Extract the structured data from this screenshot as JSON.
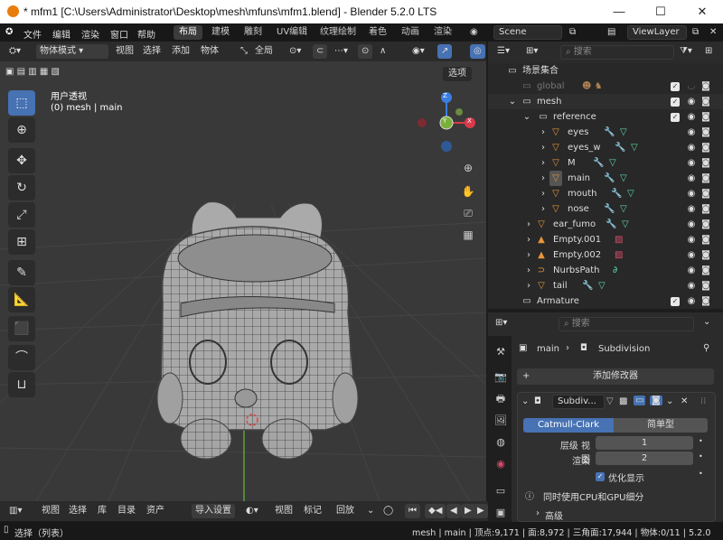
{
  "window": {
    "title": "* mfm1 [C:\\Users\\Administrator\\Desktop\\mesh\\mfuns\\mfm1.blend] - Blender 5.2.0 LTS",
    "minimize": "—",
    "maximize": "☐",
    "close": "✕"
  },
  "menu": {
    "items": [
      "文件",
      "编辑",
      "渲染",
      "窗口",
      "帮助"
    ]
  },
  "workspaces": {
    "tabs": [
      "布局",
      "建模",
      "雕刻",
      "UV编辑",
      "纹理绘制",
      "着色",
      "动画",
      "渲染"
    ],
    "active": "布局"
  },
  "scene": {
    "label": "Scene",
    "view_layer": "ViewLayer"
  },
  "viewport_header": {
    "mode": "物体模式",
    "menus": [
      "视图",
      "选择",
      "添加",
      "物体"
    ],
    "transform": "全局",
    "options": "选项"
  },
  "viewport": {
    "view_name": "用户透视",
    "context": "(0) mesh | main"
  },
  "gizmo": {
    "x": "X",
    "y": "Y",
    "z": "Z"
  },
  "outliner": {
    "search_placeholder": "搜索",
    "root": "场景集合",
    "rows": [
      {
        "name": "global",
        "dim": true
      },
      {
        "name": "mesh"
      },
      {
        "name": "reference"
      },
      {
        "name": "eyes"
      },
      {
        "name": "eyes_w"
      },
      {
        "name": "M"
      },
      {
        "name": "main"
      },
      {
        "name": "mouth"
      },
      {
        "name": "nose"
      },
      {
        "name": "ear_fumo"
      },
      {
        "name": "Empty.001"
      },
      {
        "name": "Empty.002"
      },
      {
        "name": "NurbsPath"
      },
      {
        "name": "tail"
      },
      {
        "name": "Armature"
      }
    ]
  },
  "properties": {
    "search_placeholder": "搜索",
    "breadcrumb_object": "main",
    "breadcrumb_modifier": "Subdivision",
    "add_modifier": "添加修改器",
    "modifier_name": "Subdiv...",
    "catmull": "Catmull-Clark",
    "simple": "简单型",
    "levels_label": "层级 视图",
    "levels_value": "1",
    "render_label": "渲染",
    "render_value": "2",
    "optimal_display": "优化显示",
    "gpu_info": "同时使用CPU和GPU细分",
    "advanced": "高级"
  },
  "timeline": {
    "menus": [
      "视图",
      "选择",
      "库",
      "目录",
      "资产"
    ],
    "import": "导入设置",
    "menus2": [
      "视图",
      "标记"
    ],
    "playback": "回放"
  },
  "status": {
    "left": "选择（列表）",
    "right": "mesh | main | 顶点:9,171 | 面:8,972 | 三角面:17,944 | 物体:0/11 | 5.2.0"
  }
}
